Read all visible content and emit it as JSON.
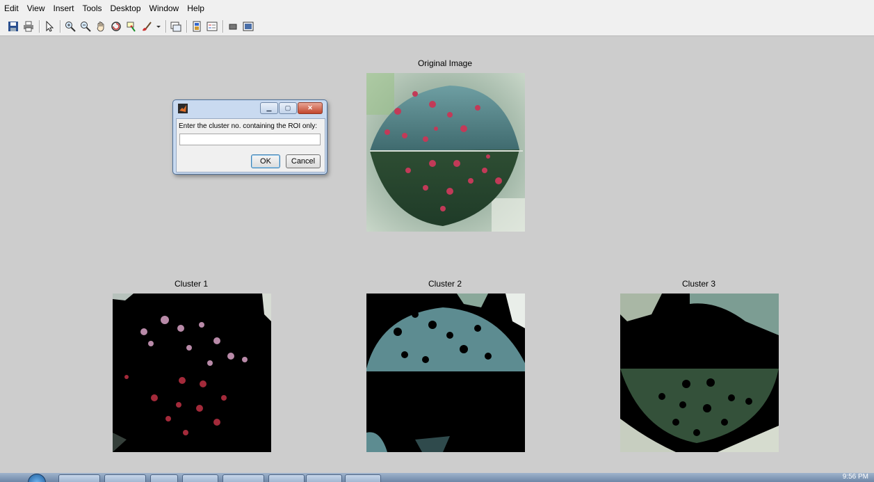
{
  "menu": [
    "Edit",
    "View",
    "Insert",
    "Tools",
    "Desktop",
    "Window",
    "Help"
  ],
  "toolbar_icons": [
    "save-icon",
    "print-icon",
    "pointer-icon",
    "zoom-in-icon",
    "zoom-out-icon",
    "pan-hand-icon",
    "rotate-icon",
    "data-cursor-icon",
    "brush-icon",
    "dropdown-arrow-icon",
    "link-plot-icon",
    "colorbar-icon",
    "legend-icon",
    "hide-plot-tools-icon",
    "show-plot-tools-icon"
  ],
  "axes": {
    "original_title": "Original Image",
    "cluster1_title": "Cluster 1",
    "cluster2_title": "Cluster 2",
    "cluster3_title": "Cluster 3"
  },
  "dialog": {
    "prompt": "Enter the cluster no. containing the ROI only:",
    "input_value": "",
    "ok_label": "OK",
    "cancel_label": "Cancel"
  },
  "taskbar": {
    "clock": "9:56 PM"
  },
  "colors": {
    "figure_bg": "#cdcdcd",
    "leaf_green": "#2f4a2f",
    "leaf_teal": "#4f7f7d",
    "spot_red": "#b0334a"
  }
}
